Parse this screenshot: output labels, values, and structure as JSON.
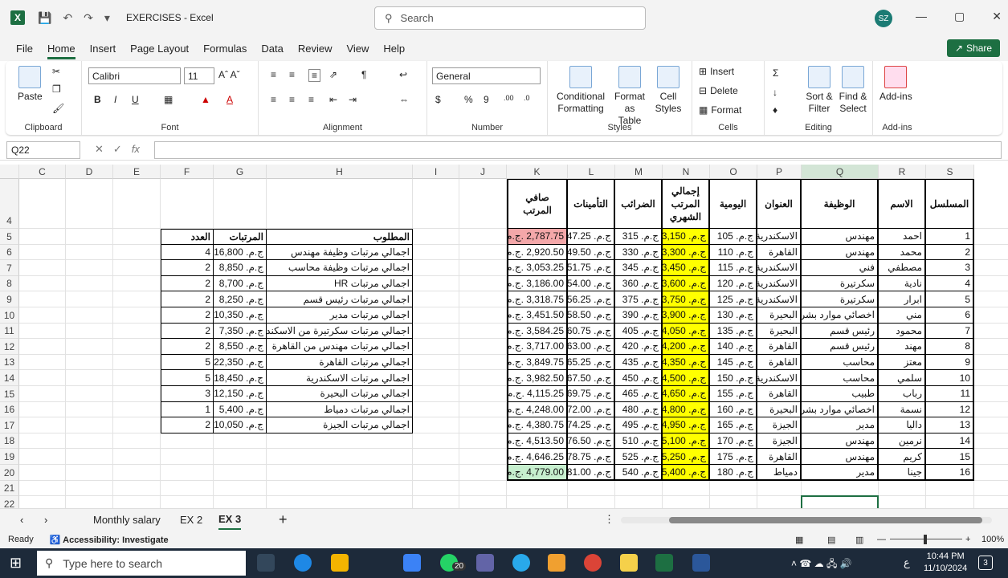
{
  "title_bar": {
    "app_logo": "X",
    "doc_title": "EXERCISES  -  Excel",
    "search_placeholder": "Search",
    "avatar": "SZ",
    "min": "—",
    "max": "▢",
    "close": "✕"
  },
  "menu": [
    "File",
    "Home",
    "Insert",
    "Page Layout",
    "Formulas",
    "Data",
    "Review",
    "View",
    "Help"
  ],
  "share_label": "Share",
  "ribbon": {
    "clipboard": {
      "label": "Clipboard",
      "paste": "Paste"
    },
    "font": {
      "label": "Font",
      "name": "Calibri",
      "size": "11"
    },
    "alignment": {
      "label": "Alignment"
    },
    "number": {
      "label": "Number",
      "format": "General"
    },
    "styles": {
      "label": "Styles",
      "cond": "Conditional Formatting",
      "table": "Format as Table",
      "cell": "Cell Styles"
    },
    "cells": {
      "label": "Cells",
      "insert": "Insert",
      "delete": "Delete",
      "format": "Format"
    },
    "editing": {
      "label": "Editing",
      "sort": "Sort & Filter",
      "find": "Find & Select"
    },
    "addins": {
      "label": "Add-ins",
      "btn": "Add-ins"
    }
  },
  "formula_bar": {
    "name_box": "Q22",
    "fx": "fx",
    "value": ""
  },
  "columns": [
    "C",
    "D",
    "E",
    "F",
    "G",
    "H",
    "I",
    "J",
    "K",
    "L",
    "M",
    "N",
    "O",
    "P",
    "Q",
    "R",
    "S"
  ],
  "rows": [
    "4",
    "5",
    "6",
    "7",
    "8",
    "9",
    "10",
    "11",
    "12",
    "13",
    "14",
    "15",
    "16",
    "17",
    "18",
    "19",
    "20",
    "21",
    "22"
  ],
  "summary": {
    "headers": {
      "required": "المطلوب",
      "salaries": "المرتبات",
      "count": "العدد"
    },
    "rows": [
      {
        "desc": "اجمالي مرتبات وظيفة مهندس",
        "amount": "ج.م. 16,800",
        "count": "4"
      },
      {
        "desc": "اجمالي مرتبات وظيفة محاسب",
        "amount": "ج.م. 8,850",
        "count": "2"
      },
      {
        "desc": "اجمالي مرتبات HR",
        "amount": "ج.م. 8,700",
        "count": "2"
      },
      {
        "desc": "اجمالي مرتبات رئيس قسم",
        "amount": "ج.م. 8,250",
        "count": "2"
      },
      {
        "desc": "اجمالي مرتبات مدير",
        "amount": "ج.م. 10,350",
        "count": "2"
      },
      {
        "desc": "اجمالي مرتبات سكرتيرة من الاسكندرية",
        "amount": "ج.م. 7,350",
        "count": "2"
      },
      {
        "desc": "اجمالي مرتبات مهندس من القاهرة",
        "amount": "ج.م. 8,550",
        "count": "2"
      },
      {
        "desc": "اجمالي مرتبات القاهرة",
        "amount": "ج.م. 22,350",
        "count": "5"
      },
      {
        "desc": "اجمالي مرتبات الاسكندرية",
        "amount": "ج.م. 18,450",
        "count": "5"
      },
      {
        "desc": "اجمالي مرتبات البحيرة",
        "amount": "ج.م. 12,150",
        "count": "3"
      },
      {
        "desc": "اجمالي مرتبات دمياط",
        "amount": "ج.م. 5,400",
        "count": "1"
      },
      {
        "desc": "اجمالي مرتبات الجيزة",
        "amount": "ج.م. 10,050",
        "count": "2"
      }
    ]
  },
  "salary": {
    "headers": {
      "net": "صافي المرتب",
      "insurance": "التأمينات",
      "tax": "الضرائب",
      "monthly": "إجمالي المرتب الشهري",
      "daily": "اليومية",
      "address": "العنوان",
      "job": "الوظيفة",
      "name": "الاسم",
      "serial": "المسلسل"
    },
    "rows": [
      {
        "net": "2,787.75 .ج.م",
        "ins": "ج.م. 47.25",
        "tax": "ج.م. 315",
        "monthly": "ج.م. 3,150",
        "daily": "ج.م. 105",
        "addr": "الاسكندرية",
        "job": "مهندس",
        "name": "احمد",
        "serial": "1"
      },
      {
        "net": "2,920.50 .ج.م",
        "ins": "ج.م. 49.50",
        "tax": "ج.م. 330",
        "monthly": "ج.م. 3,300",
        "daily": "ج.م. 110",
        "addr": "القاهرة",
        "job": "مهندس",
        "name": "محمد",
        "serial": "2"
      },
      {
        "net": "3,053.25 .ج.م",
        "ins": "ج.م. 51.75",
        "tax": "ج.م. 345",
        "monthly": "ج.م. 3,450",
        "daily": "ج.م. 115",
        "addr": "الاسكندرية",
        "job": "فني",
        "name": "مصطفي",
        "serial": "3"
      },
      {
        "net": "3,186.00 .ج.م",
        "ins": "ج.م. 54.00",
        "tax": "ج.م. 360",
        "monthly": "ج.م. 3,600",
        "daily": "ج.م. 120",
        "addr": "الاسكندرية",
        "job": "سكرتيرة",
        "name": "نادية",
        "serial": "4"
      },
      {
        "net": "3,318.75 .ج.م",
        "ins": "ج.م. 56.25",
        "tax": "ج.م. 375",
        "monthly": "ج.م. 3,750",
        "daily": "ج.م. 125",
        "addr": "الاسكندرية",
        "job": "سكرتيرة",
        "name": "ابرار",
        "serial": "5"
      },
      {
        "net": "3,451.50 .ج.م",
        "ins": "ج.م. 58.50",
        "tax": "ج.م. 390",
        "monthly": "ج.م. 3,900",
        "daily": "ج.م. 130",
        "addr": "البحيرة",
        "job": "اخصائي موارد بشرية",
        "name": "مني",
        "serial": "6"
      },
      {
        "net": "3,584.25 .ج.م",
        "ins": "ج.م. 60.75",
        "tax": "ج.م. 405",
        "monthly": "ج.م. 4,050",
        "daily": "ج.م. 135",
        "addr": "البحيرة",
        "job": "رئيس قسم",
        "name": "محمود",
        "serial": "7"
      },
      {
        "net": "3,717.00 .ج.م",
        "ins": "ج.م. 63.00",
        "tax": "ج.م. 420",
        "monthly": "ج.م. 4,200",
        "daily": "ج.م. 140",
        "addr": "القاهرة",
        "job": "رئيس قسم",
        "name": "مهند",
        "serial": "8"
      },
      {
        "net": "3,849.75 .ج.م",
        "ins": "ج.م. 65.25",
        "tax": "ج.م. 435",
        "monthly": "ج.م. 4,350",
        "daily": "ج.م. 145",
        "addr": "القاهرة",
        "job": "محاسب",
        "name": "معتز",
        "serial": "9"
      },
      {
        "net": "3,982.50 .ج.م",
        "ins": "ج.م. 67.50",
        "tax": "ج.م. 450",
        "monthly": "ج.م. 4,500",
        "daily": "ج.م. 150",
        "addr": "الاسكندرية",
        "job": "محاسب",
        "name": "سلمي",
        "serial": "10"
      },
      {
        "net": "4,115.25 .ج.م",
        "ins": "ج.م. 69.75",
        "tax": "ج.م. 465",
        "monthly": "ج.م. 4,650",
        "daily": "ج.م. 155",
        "addr": "القاهرة",
        "job": "طبيب",
        "name": "رباب",
        "serial": "11"
      },
      {
        "net": "4,248.00 .ج.م",
        "ins": "ج.م. 72.00",
        "tax": "ج.م. 480",
        "monthly": "ج.م. 4,800",
        "daily": "ج.م. 160",
        "addr": "البحيرة",
        "job": "اخصائي موارد بشرية",
        "name": "نسمة",
        "serial": "12"
      },
      {
        "net": "4,380.75 .ج.م",
        "ins": "ج.م. 74.25",
        "tax": "ج.م. 495",
        "monthly": "ج.م. 4,950",
        "daily": "ج.م. 165",
        "addr": "الجيزة",
        "job": "مدير",
        "name": "داليا",
        "serial": "13"
      },
      {
        "net": "4,513.50 .ج.م",
        "ins": "ج.م. 76.50",
        "tax": "ج.م. 510",
        "monthly": "ج.م. 5,100",
        "daily": "ج.م. 170",
        "addr": "الجيزة",
        "job": "مهندس",
        "name": "نرمين",
        "serial": "14"
      },
      {
        "net": "4,646.25 .ج.م",
        "ins": "ج.م. 78.75",
        "tax": "ج.م. 525",
        "monthly": "ج.م. 5,250",
        "daily": "ج.م. 175",
        "addr": "القاهرة",
        "job": "مهندس",
        "name": "كريم",
        "serial": "15"
      },
      {
        "net": "4,779.00 .ج.م",
        "ins": "ج.م. 81.00",
        "tax": "ج.م. 540",
        "monthly": "ج.م. 5,400",
        "daily": "ج.م. 180",
        "addr": "دمياط",
        "job": "مدير",
        "name": "جينا",
        "serial": "16"
      }
    ]
  },
  "sheet_tabs": [
    "Monthly salary",
    "EX 2",
    "EX 3"
  ],
  "active_tab": "EX 3",
  "status": {
    "ready": "Ready",
    "accessibility": "Accessibility: Investigate",
    "zoom": "100%"
  },
  "taskbar": {
    "search_placeholder": "Type here to search",
    "badge": "20",
    "time": "10:44 PM",
    "date": "11/10/2024",
    "notif": "3",
    "lang": "ع"
  },
  "colors": {
    "excel_green": "#1d6f42",
    "highlight_yellow": "#ffff00",
    "min_red": "#f4a7a9",
    "max_green": "#c6efce"
  }
}
